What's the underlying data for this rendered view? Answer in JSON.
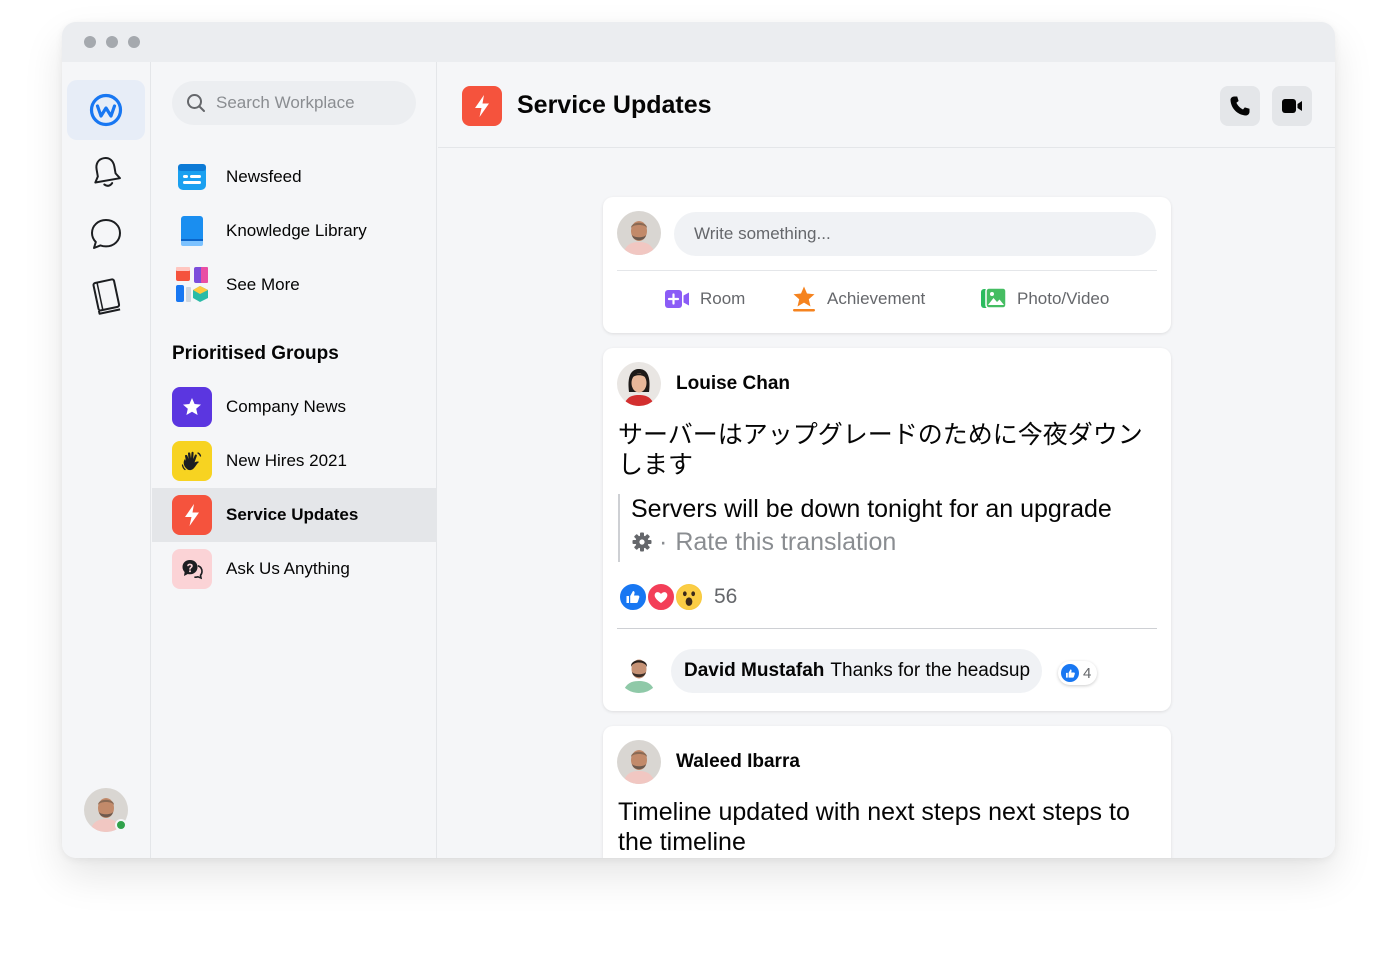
{
  "search": {
    "placeholder": "Search Workplace"
  },
  "nav": {
    "items": [
      {
        "label": "Newsfeed",
        "icon": "newsfeed-icon"
      },
      {
        "label": "Knowledge Library",
        "icon": "book-icon"
      },
      {
        "label": "See More",
        "icon": "apps-icon"
      }
    ],
    "section_title": "Prioritised Groups",
    "groups": [
      {
        "label": "Company News",
        "icon": "star-icon",
        "color": "#5b36e0"
      },
      {
        "label": "New Hires 2021",
        "icon": "waving-hand-icon",
        "color": "#f7d321"
      },
      {
        "label": "Service Updates",
        "icon": "lightning-icon",
        "color": "#f5533d",
        "selected": true
      },
      {
        "label": "Ask Us Anything",
        "icon": "question-chat-icon",
        "color": "#fbd3d6"
      }
    ]
  },
  "header": {
    "title": "Service Updates"
  },
  "composer": {
    "placeholder": "Write something...",
    "actions": [
      "Room",
      "Achievement",
      "Photo/Video"
    ]
  },
  "posts": [
    {
      "author": "Louise Chan",
      "text": "サーバーはアップグレードのために今夜ダウンします",
      "translation": "Servers will be down tonight for an upgrade",
      "rate_label": "Rate this translation",
      "reaction_count": "56",
      "comment": {
        "author": "David Mustafah",
        "text": "Thanks for the headsup",
        "likes": "4"
      }
    },
    {
      "author": "Waleed Ibarra",
      "text": "Timeline updated with next steps next steps to the timeline"
    }
  ],
  "colors": {
    "accent": "#1877f2",
    "service_red": "#f5533d",
    "background": "#f5f6f8"
  }
}
